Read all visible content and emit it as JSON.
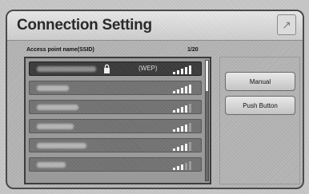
{
  "header": {
    "title": "Connection Setting"
  },
  "list": {
    "column_label": "Access point name(SSID)",
    "page_indicator": "1/20",
    "rows": [
      {
        "security": "(WEP)",
        "locked": true,
        "selected": true,
        "signal_bars": 5
      },
      {
        "security": "",
        "locked": false,
        "selected": false,
        "signal_bars": 5
      },
      {
        "security": "",
        "locked": false,
        "selected": false,
        "signal_bars": 4
      },
      {
        "security": "",
        "locked": false,
        "selected": false,
        "signal_bars": 4
      },
      {
        "security": "",
        "locked": false,
        "selected": false,
        "signal_bars": 4
      },
      {
        "security": "",
        "locked": false,
        "selected": false,
        "signal_bars": 3
      }
    ]
  },
  "buttons": {
    "manual": "Manual",
    "push": "Push Button"
  },
  "icons": {
    "corner": "arrow-icon",
    "lock": "lock-icon",
    "signal": "signal-strength-icon"
  },
  "colors": {
    "selected_row": "#3a3a3a",
    "row": "#707070",
    "panel": "#b7b7b7"
  }
}
